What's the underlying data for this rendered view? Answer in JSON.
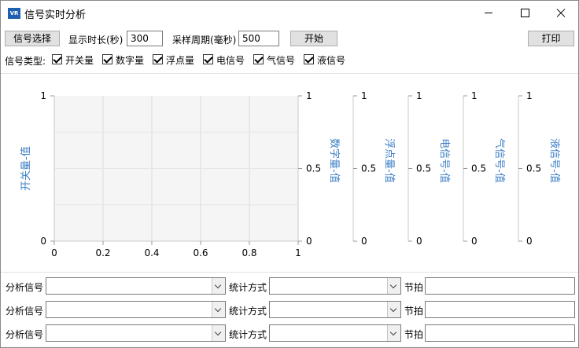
{
  "window": {
    "app_icon_text": "VR",
    "title": "信号实时分析"
  },
  "toolbar": {
    "signal_select_label": "信号选择",
    "display_duration_label": "显示时长(秒)",
    "display_duration_value": "300",
    "sample_period_label": "采样周期(毫秒)",
    "sample_period_value": "500",
    "start_label": "开始",
    "print_label": "打印"
  },
  "signal_types": {
    "label": "信号类型:",
    "items": [
      {
        "label": "开关量",
        "checked": true
      },
      {
        "label": "数字量",
        "checked": true
      },
      {
        "label": "浮点量",
        "checked": true
      },
      {
        "label": "电信号",
        "checked": true
      },
      {
        "label": "气信号",
        "checked": true
      },
      {
        "label": "液信号",
        "checked": true
      }
    ]
  },
  "chart_data": {
    "type": "line",
    "x": {
      "ticks": [
        "0",
        "0.2",
        "0.4",
        "0.6",
        "0.8",
        "1"
      ],
      "range": [
        0,
        1
      ]
    },
    "y_axes": [
      {
        "title": "开关量-值",
        "ticks": [
          "0",
          "1"
        ],
        "range": [
          0,
          1
        ],
        "side": "left"
      },
      {
        "title": "数字量-值",
        "ticks": [
          "0",
          "0.5",
          "1"
        ],
        "range": [
          0,
          1
        ],
        "side": "right"
      },
      {
        "title": "浮点量-值",
        "ticks": [
          "0",
          "0.5",
          "1"
        ],
        "range": [
          0,
          1
        ],
        "side": "right"
      },
      {
        "title": "电信号-值",
        "ticks": [
          "0",
          "0.5",
          "1"
        ],
        "range": [
          0,
          1
        ],
        "side": "right"
      },
      {
        "title": "气信号-值",
        "ticks": [
          "0",
          "0.5",
          "1"
        ],
        "range": [
          0,
          1
        ],
        "side": "right"
      },
      {
        "title": "液信号-值",
        "ticks": [
          "0",
          "0.5",
          "1"
        ],
        "range": [
          0,
          1
        ],
        "side": "right"
      }
    ],
    "series": [],
    "grid": true
  },
  "analysis_rows": [
    {
      "signal_label": "分析信号",
      "stat_label": "统计方式",
      "beat_label": "节拍"
    },
    {
      "signal_label": "分析信号",
      "stat_label": "统计方式",
      "beat_label": "节拍"
    },
    {
      "signal_label": "分析信号",
      "stat_label": "统计方式",
      "beat_label": "节拍"
    }
  ],
  "colors": {
    "axis_title": "#3c7fc6",
    "plot_bg": "#f5f5f5",
    "grid": "#dcdcdc"
  }
}
